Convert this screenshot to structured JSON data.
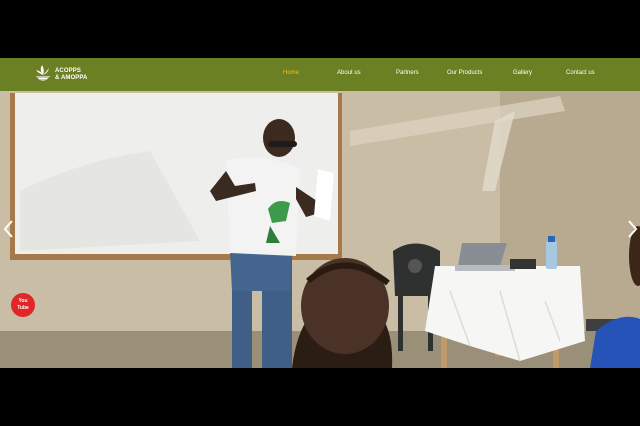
{
  "logo": {
    "line1": "ACOPPS",
    "line2": "& AMOPPA",
    "icon": "leaf-basket-logo"
  },
  "nav": {
    "items": [
      {
        "label": "Home",
        "active": true
      },
      {
        "label": "About us",
        "active": false
      },
      {
        "label": "Partners",
        "active": false
      },
      {
        "label": "Our Products",
        "active": false
      },
      {
        "label": "Gallery",
        "active": false
      },
      {
        "label": "Contact us",
        "active": false
      }
    ]
  },
  "hero": {
    "prev_icon": "chevron-left-icon",
    "next_icon": "chevron-right-icon"
  },
  "social": {
    "youtube_label": "You Tube",
    "icon": "youtube-icon"
  },
  "colors": {
    "nav_bg": "#6b7f23",
    "active": "#f2c01e",
    "youtube": "#e02626"
  }
}
